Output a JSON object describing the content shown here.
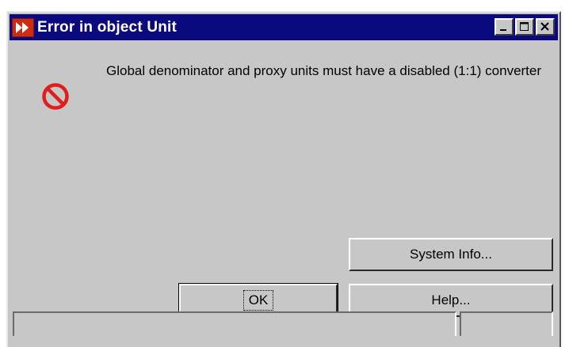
{
  "window": {
    "title": "Error in object Unit",
    "controls": {
      "minimize_icon": "minimize-icon",
      "maximize_icon": "maximize-icon",
      "close_icon": "close-icon"
    }
  },
  "dialog": {
    "icon": "prohibited-icon",
    "message": "Global denominator and proxy units must have a disabled (1:1) converter"
  },
  "buttons": {
    "system_info": "System Info...",
    "ok": "OK",
    "help": "Help..."
  },
  "status_bar": {
    "main": "",
    "side": ""
  },
  "colors": {
    "titlebar": "#0a0a7e",
    "window_bg": "#c7c7c7",
    "error_icon": "#e01e1e",
    "app_icon": "#cf2a12"
  }
}
